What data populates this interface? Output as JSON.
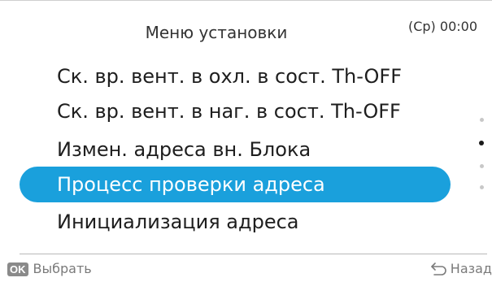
{
  "header": {
    "title": "Меню установки",
    "clock": "(Ср) 00:00"
  },
  "menu": {
    "items": [
      {
        "label": "Ск. вр. вент. в охл. в сост. Th-OFF",
        "selected": false
      },
      {
        "label": "Ск. вр. вент. в наг. в сост. Th-OFF",
        "selected": false
      },
      {
        "label": "Измен. адреса вн. Блока",
        "selected": false
      },
      {
        "label": "Процесс проверки адреса",
        "selected": true
      },
      {
        "label": "Инициализация адреса",
        "selected": false
      }
    ],
    "selected_index": 3
  },
  "pager": {
    "page_count": 4,
    "current_page": 2
  },
  "footer": {
    "ok_badge": "OK",
    "ok_label": "Выбрать",
    "back_label": "Назад",
    "back_icon": "return-arrow-icon"
  },
  "colors": {
    "selection": "#1aa0dc",
    "text": "#1e1e1e",
    "muted": "#7a7a7a"
  }
}
